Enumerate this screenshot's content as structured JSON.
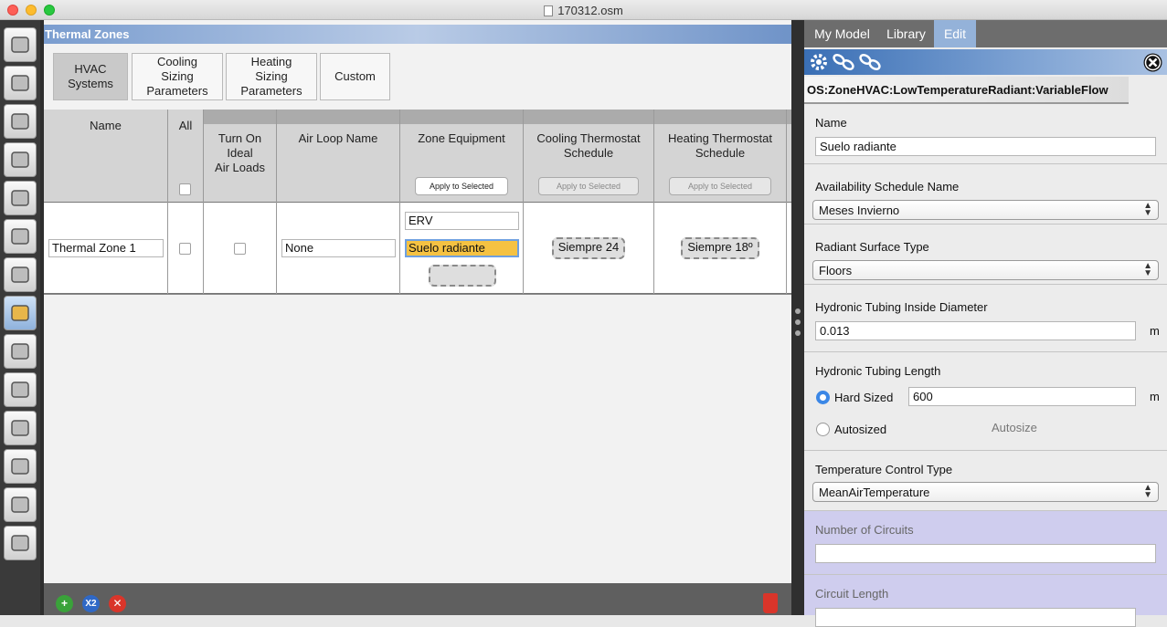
{
  "window": {
    "title": "170312.osm"
  },
  "nav": {
    "icons": [
      "site-globe-icon",
      "schedules-calendar-icon",
      "constructions-brick-icon",
      "loads-plug-icon",
      "space-types-cube-icon",
      "geometry-building-icon",
      "facility-box-icon",
      "thermal-zones-cube-icon",
      "hvac-systems-loop-icon",
      "variables-icon",
      "simulation-settings-gear-icon",
      "scripts-scroll-icon",
      "run-play-icon",
      "results-chart-icon"
    ],
    "active": "thermal-zones-cube-icon"
  },
  "main": {
    "header": "Thermal Zones",
    "subtabs": [
      {
        "label": "HVAC\nSystems",
        "selected": true
      },
      {
        "label": "Cooling\nSizing\nParameters",
        "selected": false
      },
      {
        "label": "Heating\nSizing\nParameters",
        "selected": false
      },
      {
        "label": "Custom",
        "selected": false
      }
    ],
    "grid": {
      "columns": {
        "name": "Name",
        "all": "All",
        "ideal": "Turn On\nIdeal\nAir Loads",
        "airloop": "Air Loop Name",
        "equipment": "Zone Equipment",
        "cooling": "Cooling Thermostat\nSchedule",
        "heating": "Heating Thermostat\nSchedule"
      },
      "apply_label": "Apply to Selected",
      "row": {
        "name": "Thermal Zone 1",
        "air_loop": "None",
        "equipment": [
          "ERV",
          "Suelo radiante"
        ],
        "cooling_schedule": "Siempre 24",
        "heating_schedule": "Siempre 18º"
      }
    },
    "footer": {
      "add": "+",
      "copy": "X2",
      "remove": "✕"
    }
  },
  "right": {
    "tabs": [
      "My Model",
      "Library",
      "Edit"
    ],
    "active_tab": "Edit",
    "object_type": "OS:ZoneHVAC:LowTemperatureRadiant:VariableFlow",
    "fields": {
      "name_label": "Name",
      "name_value": "Suelo radiante",
      "availability_label": "Availability Schedule Name",
      "availability_value": "Meses Invierno",
      "surface_label": "Radiant Surface Type",
      "surface_value": "Floors",
      "diameter_label": "Hydronic Tubing Inside Diameter",
      "diameter_value": "0.013",
      "diameter_unit": "m",
      "length_label": "Hydronic Tubing Length",
      "hard_sized_label": "Hard Sized",
      "length_value": "600",
      "length_unit": "m",
      "autosized_label": "Autosized",
      "autosize_button": "Autosize",
      "temp_control_label": "Temperature Control Type",
      "temp_control_value": "MeanAirTemperature",
      "circuits_label": "Number of Circuits",
      "circuits_value": "",
      "circuit_length_label": "Circuit Length",
      "circuit_length_value": ""
    }
  },
  "colors": {
    "accent": "#3b87e6",
    "selection": "#f5c242",
    "header": "#7a9dcf",
    "disabled_section": "#cfcdee"
  }
}
